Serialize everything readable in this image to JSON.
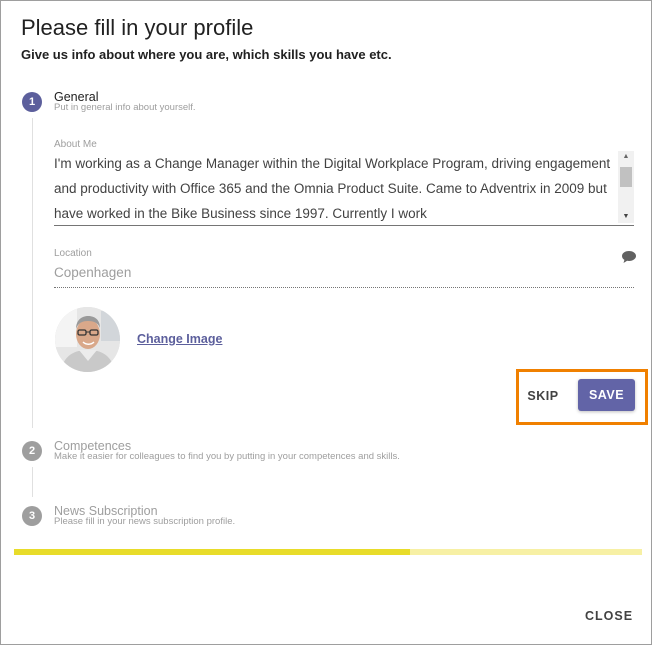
{
  "dialog": {
    "title": "Please fill in your profile",
    "subtitle": "Give us info about where you are, which skills you have etc."
  },
  "steps": [
    {
      "number": "1",
      "title": "General",
      "description": "Put in general info about yourself.",
      "state": "active"
    },
    {
      "number": "2",
      "title": "Competences",
      "description": "Make it easier for colleagues to find you by putting in your competences and skills.",
      "state": "inactive"
    },
    {
      "number": "3",
      "title": "News Subscription",
      "description": "Please fill in your news subscription profile.",
      "state": "inactive"
    }
  ],
  "about_me": {
    "label": "About Me",
    "value": "I'm working as a Change Manager within the Digital Workplace Program, driving engagement and productivity with Office 365 and the Omnia Product Suite. Came to Adventrix in 2009 but have worked in the Bike Business since 1997. Currently I work"
  },
  "location": {
    "label": "Location",
    "value": "Copenhagen",
    "icon": "comment-icon"
  },
  "avatar": {
    "icon": "avatar-photo"
  },
  "change_image_label": "Change Image",
  "actions": {
    "skip_label": "SKIP",
    "save_label": "SAVE"
  },
  "progress": {
    "fraction": 0.63
  },
  "footer": {
    "close_label": "CLOSE"
  },
  "colors": {
    "accent": "#6264a7",
    "step_active": "#5c5f9c",
    "step_inactive": "#9e9e9e",
    "highlight": "#f08000",
    "progress_fill": "#e8dc2a",
    "progress_track": "#f7f0a4"
  }
}
